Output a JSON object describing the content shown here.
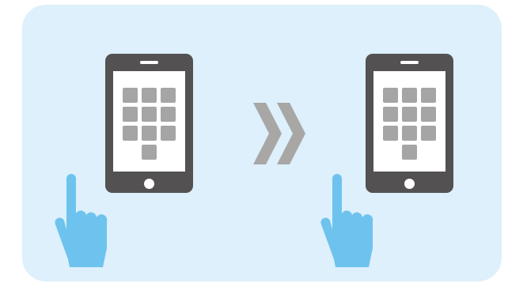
{
  "colors": {
    "panel": "#ddf0fb",
    "phone_body": "#535152",
    "phone_screen": "#ffffff",
    "key": "#a6a5a5",
    "arrow": "#a8a7a6",
    "hand": "#6ec3ee"
  },
  "illustration": {
    "steps": [
      {
        "phone_icon": "smartphone-keypad-icon",
        "hand_icon": "pointing-hand-icon"
      },
      {
        "phone_icon": "smartphone-keypad-icon",
        "hand_icon": "pointing-hand-icon"
      }
    ],
    "separator_icon": "double-chevron-right-icon"
  }
}
